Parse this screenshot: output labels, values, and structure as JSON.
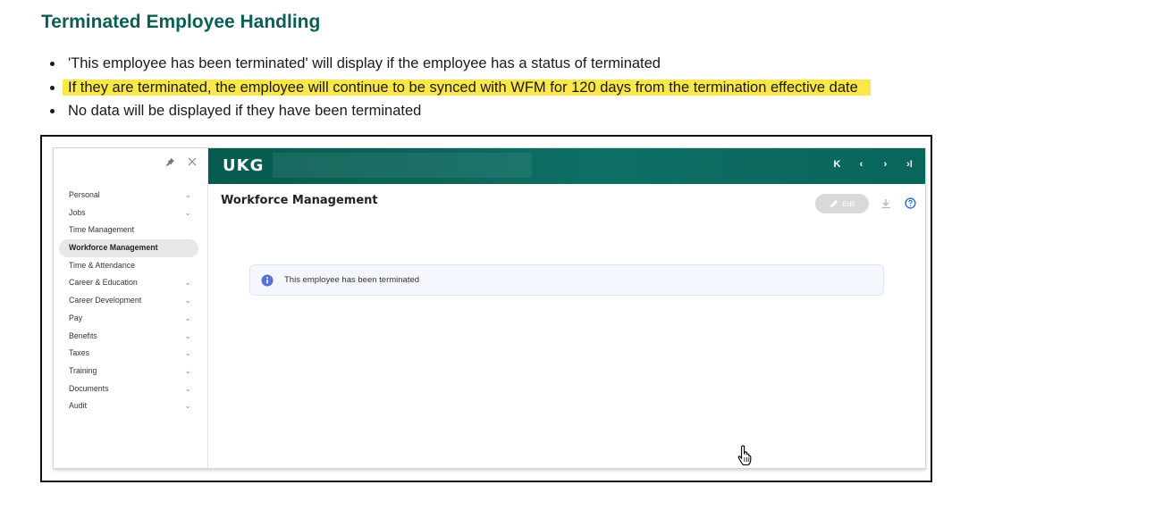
{
  "doc": {
    "title": "Terminated Employee Handling",
    "bullets": [
      "'This employee has been terminated' will display if the employee has a status of terminated",
      "If they are terminated, the employee will continue to be synced with WFM for 120 days from the termination effective date",
      "No data will be displayed if they have been terminated"
    ],
    "highlight_color": "#fbe74a",
    "title_color": "#0b5e55"
  },
  "app": {
    "logo": "UKG",
    "brand_color": "#0b6a5f",
    "sidebar": {
      "items": [
        {
          "label": "Personal",
          "chevron": "⌄"
        },
        {
          "label": "Jobs",
          "chevron": "⌄"
        },
        {
          "label": "Time Management",
          "chevron": ""
        },
        {
          "label": "Workforce Management",
          "chevron": ""
        },
        {
          "label": "Time & Attendance",
          "chevron": ""
        },
        {
          "label": "Career & Education",
          "chevron": "⌄"
        },
        {
          "label": "Career Development",
          "chevron": "⌄"
        },
        {
          "label": "Pay",
          "chevron": "⌄"
        },
        {
          "label": "Benefits",
          "chevron": "⌄"
        },
        {
          "label": "Taxes",
          "chevron": "⌄"
        },
        {
          "label": "Training",
          "chevron": "⌄"
        },
        {
          "label": "Documents",
          "chevron": "⌄"
        },
        {
          "label": "Audit",
          "chevron": "⌄"
        }
      ],
      "active_index": 3,
      "pin_icon": "pin-icon",
      "close_icon": "close-icon"
    },
    "pager": {
      "first": "K",
      "prev": "‹",
      "next": "›",
      "last": "›I"
    },
    "page_title": "Workforce Management",
    "edit_label": "Edit",
    "notice_text": "This employee has been terminated"
  }
}
